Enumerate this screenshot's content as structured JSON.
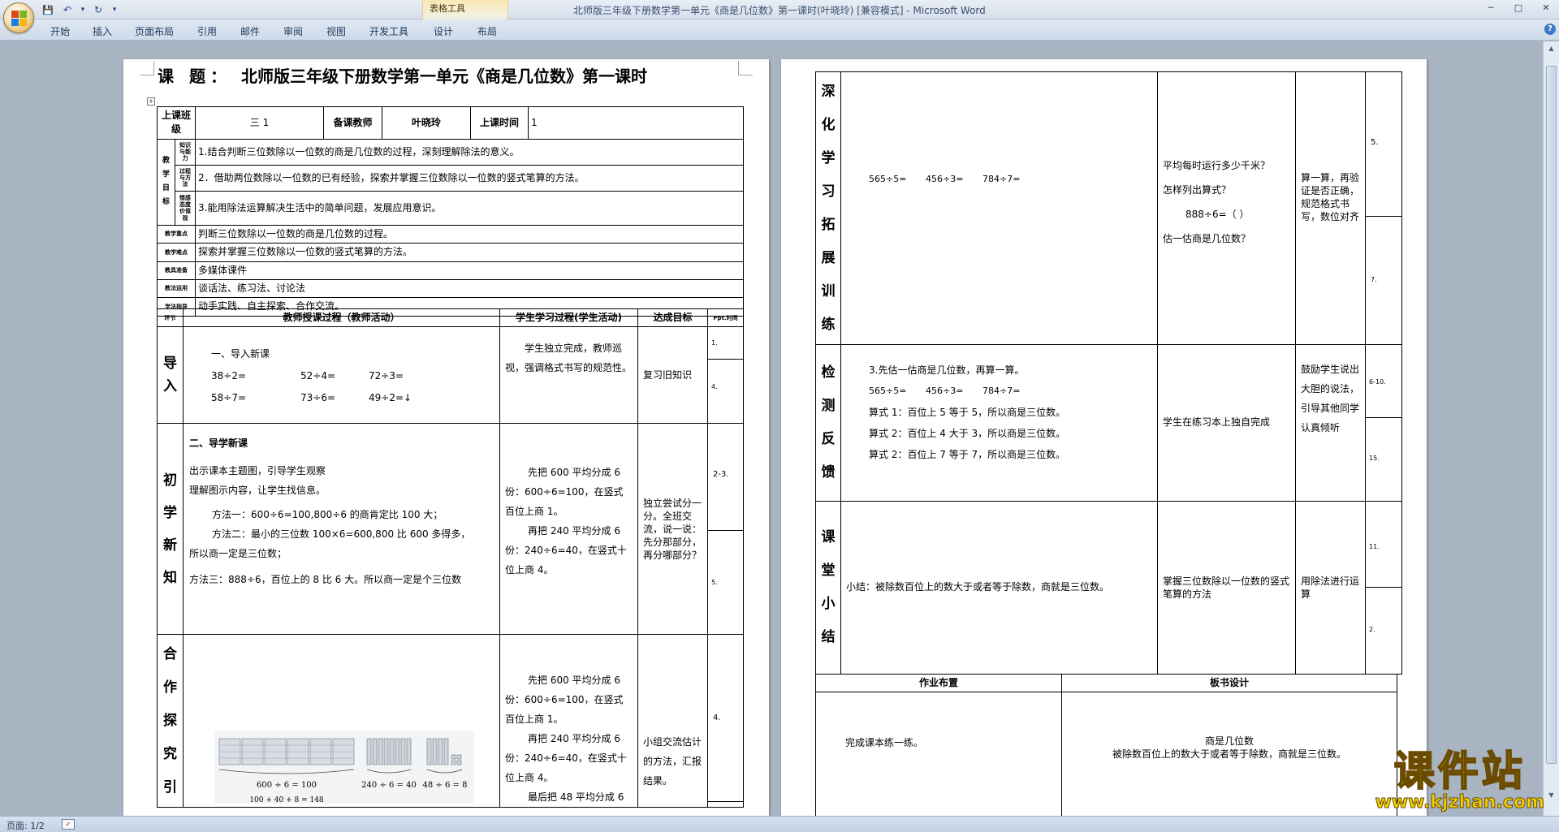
{
  "window": {
    "title": "北师版三年级下册数学第一单元《商是几位数》第一课时(叶晓玲) [兼容模式] - Microsoft Word",
    "contextual_group": "表格工具",
    "controls": [
      "─",
      "□",
      "✕"
    ]
  },
  "qat": {
    "save": "💾",
    "undo": "↶",
    "undo_drop": "▾",
    "redo": "↻",
    "customize": "▾"
  },
  "ribbon_tabs": [
    "开始",
    "插入",
    "页面布局",
    "引用",
    "邮件",
    "审阅",
    "视图",
    "开发工具",
    "设计",
    "布局"
  ],
  "help": "?",
  "status": {
    "page": "页面: 1/2",
    "spell_icon": "✓"
  },
  "page1": {
    "title_label": "课 题：",
    "title": "北师版三年级下册数学第一单元《商是几位数》第一课时",
    "info": {
      "class_label": "上课班级",
      "class_value": "三 1",
      "teacher_label": "备课教师",
      "teacher_value": "叶晓玲",
      "time_label": "上课时间",
      "time_value": "1"
    },
    "goals_label": [
      "教",
      "学",
      "目",
      "标"
    ],
    "goal_sub_labels": [
      "知识与能力",
      "过程与方法",
      "情感态度价值观"
    ],
    "goals": [
      "1.结合判断三位数除以一位数的商是几位数的过程，深刻理解除法的意义。",
      "2．借助两位数除以一位数的已有经验，探索并掌握三位数除以一位数的竖式笔算的方法。",
      "3.能用除法运算解决生活中的简单问题，发展应用意识。"
    ],
    "rows": [
      {
        "label": "教学重点",
        "value": "判断三位数除以一位数的商是几位数的过程。"
      },
      {
        "label": "教学难点",
        "value": "探索并掌握三位数除以一位数的竖式笔算的方法。"
      },
      {
        "label": "教具准备",
        "value": "多媒体课件"
      },
      {
        "label": "教法运用",
        "value": "谈话法、练习法、讨论法"
      },
      {
        "label": "学法指导",
        "value": "动手实践、自主探索、合作交流。"
      }
    ],
    "process_headers": {
      "step": "环节",
      "teacher": "教师授课过程（教师活动）",
      "student": "学生学习过程(学生活动)",
      "goal": "达成目标",
      "time": "Ppt.时间"
    },
    "intro": {
      "label": [
        "导",
        "入"
      ],
      "heading": "一、导入新课",
      "problems_row1": [
        "38÷2=",
        "52÷4=",
        "72÷3="
      ],
      "problems_row2": [
        "58÷7=",
        "73÷6=",
        "49÷2=↓"
      ],
      "student": "学生独立完成，教师巡视，强调格式书写的规范性。",
      "goal": "复习旧知识",
      "times": [
        "1.",
        "4."
      ]
    },
    "new": {
      "label": [
        "初",
        "学",
        "新",
        "知"
      ],
      "heading": "二、导学新课",
      "lines": [
        "出示课本主题图，引导学生观察",
        "理解图示内容，让学生找信息。",
        "方法一：600÷6=100,800÷6 的商肯定比 100 大；",
        "方法二：最小的三位数 100×6=600,800 比 600 多得多，",
        "所以商一定是三位数；",
        "方法三：888÷6，百位上的 8 比 6 大。所以商一定是个三位数"
      ],
      "student_lines": [
        "先把 600 平均分成 6",
        "份：600÷6=100，在竖式",
        "百位上商 1。",
        "再把 240 平均分成 6",
        "份：240÷6=40，在竖式十",
        "位上商 4。"
      ],
      "goal": "独立尝试分一分。全班交流，说一说：先分那部分，再分哪部分？",
      "times": [
        "2-3.",
        "5."
      ]
    },
    "coop": {
      "label": [
        "合",
        "作",
        "探",
        "究",
        "引"
      ],
      "figure_captions": [
        "600 ÷ 6 = 100",
        "240 ÷ 6 = 40",
        "48 ÷ 6 = 8",
        "100 + 40 + 8 = 148"
      ],
      "student_lines": [
        "先把 600 平均分成 6",
        "份：600÷6=100，在竖式",
        "百位上商 1。",
        "再把 240 平均分成 6",
        "份：240÷6=40，在竖式十",
        "位上商 4。",
        "最后把 48 平均分成 6"
      ],
      "goal": "小组交流估计的方法，汇报结果。",
      "times": [
        "4."
      ]
    }
  },
  "page2": {
    "deep": {
      "label": [
        "深",
        "化",
        "学",
        "习",
        "拓",
        "展",
        "训",
        "练"
      ],
      "problems": [
        "565÷5=",
        "456÷3=",
        "784÷7="
      ],
      "questions": [
        "平均每时运行多少千米？",
        "怎样列出算式？",
        "888÷6=（     ）",
        "估一估商是几位数？"
      ],
      "goal": "算一算，再验证是否正确，规范格式书写，数位对齐",
      "times": [
        "5.",
        "7."
      ]
    },
    "check": {
      "label": [
        "检",
        "测",
        "反",
        "馈"
      ],
      "lines": [
        "3.先估一估商是几位数，再算一算。"
      ],
      "problems": [
        "565÷5=",
        "456÷3=",
        "784÷7="
      ],
      "answers": [
        "算式 1：百位上 5 等于 5，所以商是三位数。",
        "算式 2：百位上 4 大于 3，所以商是三位数。",
        "算式 2：百位上 7 等于 7，所以商是三位数。"
      ],
      "student": "学生在练习本上独自完成",
      "goal": "鼓励学生说出大胆的说法，引导其他同学认真倾听",
      "times": [
        "6-10.",
        "15."
      ]
    },
    "summary": {
      "label": [
        "课",
        "堂",
        "小",
        "结"
      ],
      "text": "小结：被除数百位上的数大于或者等于除数，商就是三位数。",
      "student": "掌握三位数除以一位数的竖式笔算的方法",
      "goal": "用除法进行运算",
      "times": [
        "11.",
        "2."
      ]
    },
    "homework": {
      "header": "作业布置",
      "text": "完成课本练一练。"
    },
    "board": {
      "header": "板书设计",
      "title": "商是几位数",
      "text": "被除数百位上的数大于或者等于除数，商就是三位数。"
    }
  },
  "watermark": {
    "text": "课件站",
    "url": "www.kjzhan.com"
  },
  "colors": {
    "ribbon": "#d6dfeb",
    "workspace": "#a9b4c2",
    "watermark": "#f6d400",
    "contextual": "#f3e2b5"
  }
}
